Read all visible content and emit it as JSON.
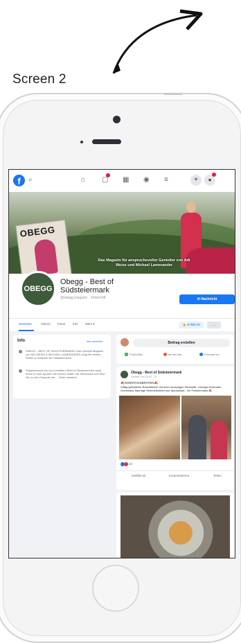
{
  "annotation": {
    "label": "Screen 2"
  },
  "facebook": {
    "nav": {
      "logo": "f",
      "search_icon": "⌕",
      "icons": [
        "⌂",
        "▢",
        "▦",
        "◉",
        "≡",
        "+",
        "●"
      ]
    },
    "cover": {
      "magazine_title": "OBEGG",
      "caption": "Das Magazin für anspruchsvoller Genießer von Adi Weiss und Michael Lamerander"
    },
    "page": {
      "avatar_text": "OBEGG",
      "name": "Obegg - Best of Südsteiermark",
      "subtitle": "@obegg.magazin · Zeitschrift",
      "message_button": "✆ Nachricht"
    },
    "tabs": [
      "Startseite",
      "Videos",
      "Fotos",
      "Info",
      "Mehr ▾"
    ],
    "like_button": "👍 Gefällt dir",
    "more_button": "…",
    "info": {
      "title": "Info",
      "link": "Alle ansehen",
      "items": [
        "OBEGG - BEST OF SÜDSTEIERMARK! Das Lifestyle Magazin von ADI WEISS & MICHAEL LAMERANDER zeigt die besten Seiten & Hotspots der Südsteiermark.",
        "Südsteiermark bis zum Umfallen! Best of Südsteiermark zeigt Ihnen in zwei Sparten die besten Seiten der Steiermark und führt Sie zu den Hotspots der ... Mehr ansehen"
      ]
    },
    "composer": {
      "button": "Beitrag erstellen",
      "actions": [
        "Foto/Video",
        "Ich bin hier",
        "Freunde ma"
      ]
    },
    "post": {
      "author": "Obegg - Best of Südsteiermark",
      "time": "Gestern um 15:00 · ⊙",
      "line1": "🍂SONNTAGSBRATEN🍂",
      "line2": "Saftig gebratener Bauchfleisch mit einer knusprigen Schwarte, cremiger Rosmarin-Gremolata, flaumige Semmelknödel und Speckkraut - ein Festschmaus 🍂",
      "reactions_count": "22",
      "actions": [
        "Gefällt mir",
        "Kommentieren",
        "Teilen"
      ]
    }
  },
  "colors": {
    "fb_blue": "#1877f2",
    "fb_bg": "#f0f2f5"
  }
}
